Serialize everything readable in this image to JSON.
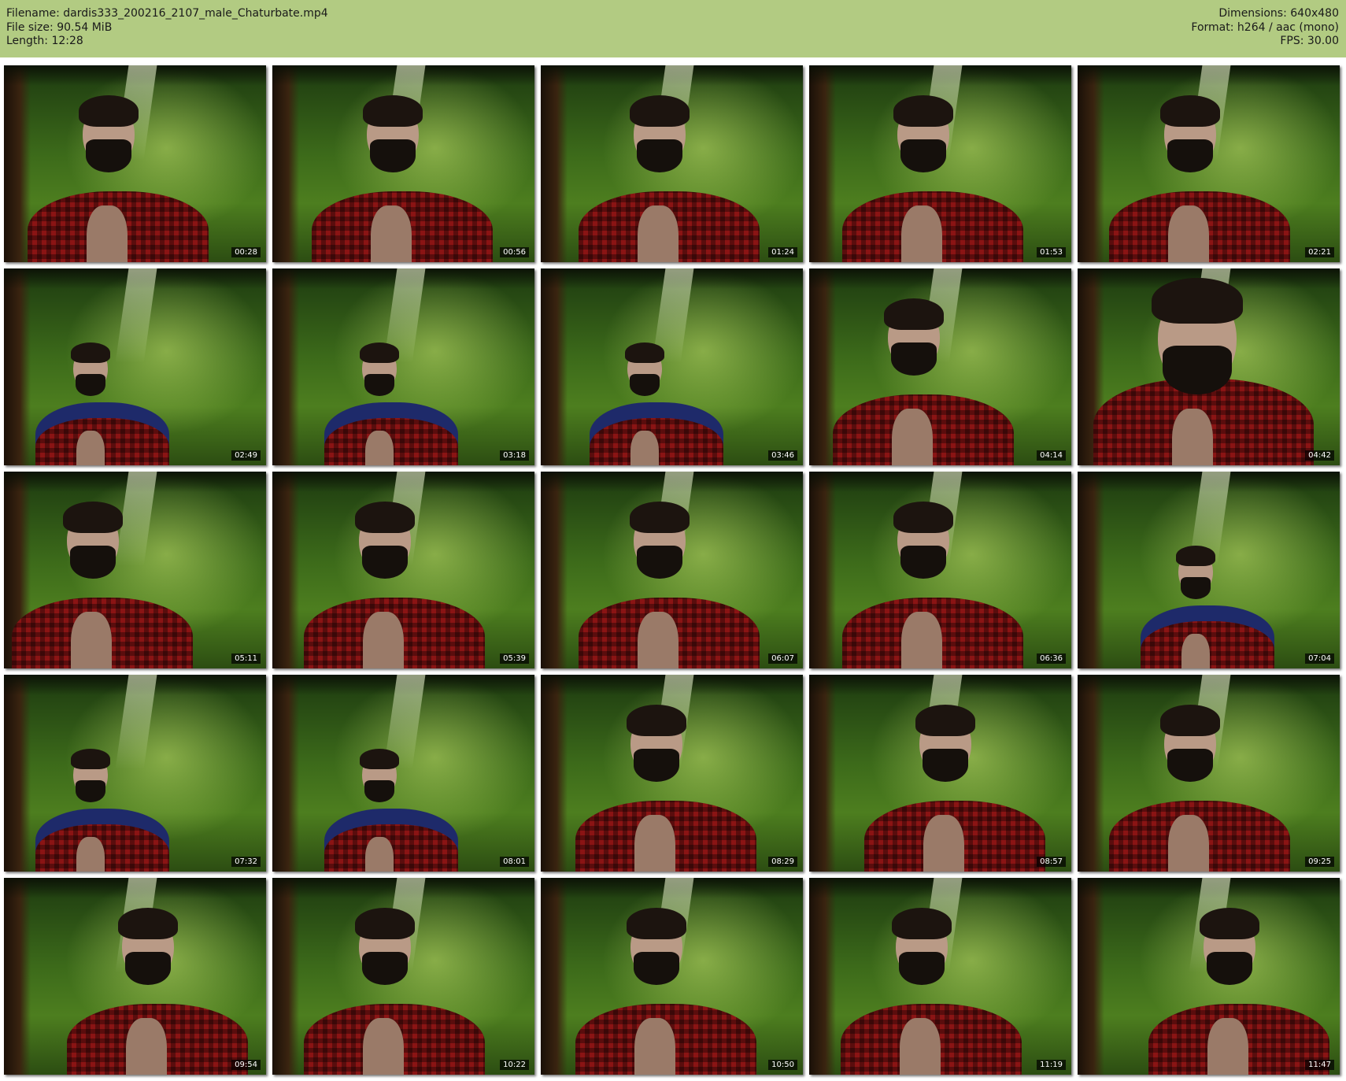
{
  "header": {
    "filename": "Filename: dardis333_200216_2107_male_Chaturbate.mp4",
    "file_size": "File size: 90.54 MiB",
    "length": "Length: 12:28",
    "dimensions": "Dimensions: 640x480",
    "format": "Format: h264 / aac (mono)",
    "fps": "FPS: 30.00"
  },
  "colors": {
    "header_background": "#b2cb82",
    "timestamp_background": "#000000",
    "timestamp_text": "#ffffff"
  },
  "thumbnails": [
    {
      "timestamp": "00:28",
      "framing": "mid"
    },
    {
      "timestamp": "00:56",
      "framing": "mid"
    },
    {
      "timestamp": "01:24",
      "framing": "mid"
    },
    {
      "timestamp": "01:53",
      "framing": "mid"
    },
    {
      "timestamp": "02:21",
      "framing": "mid"
    },
    {
      "timestamp": "02:49",
      "framing": "far"
    },
    {
      "timestamp": "03:18",
      "framing": "far"
    },
    {
      "timestamp": "03:46",
      "framing": "far"
    },
    {
      "timestamp": "04:14",
      "framing": "mid"
    },
    {
      "timestamp": "04:42",
      "framing": "near"
    },
    {
      "timestamp": "05:11",
      "framing": "mid"
    },
    {
      "timestamp": "05:39",
      "framing": "mid"
    },
    {
      "timestamp": "06:07",
      "framing": "mid"
    },
    {
      "timestamp": "06:36",
      "framing": "mid"
    },
    {
      "timestamp": "07:04",
      "framing": "far"
    },
    {
      "timestamp": "07:32",
      "framing": "far"
    },
    {
      "timestamp": "08:01",
      "framing": "far"
    },
    {
      "timestamp": "08:29",
      "framing": "mid"
    },
    {
      "timestamp": "08:57",
      "framing": "mid"
    },
    {
      "timestamp": "09:25",
      "framing": "mid"
    },
    {
      "timestamp": "09:54",
      "framing": "mid"
    },
    {
      "timestamp": "10:22",
      "framing": "mid"
    },
    {
      "timestamp": "10:50",
      "framing": "mid"
    },
    {
      "timestamp": "11:19",
      "framing": "mid"
    },
    {
      "timestamp": "11:47",
      "framing": "mid"
    }
  ]
}
